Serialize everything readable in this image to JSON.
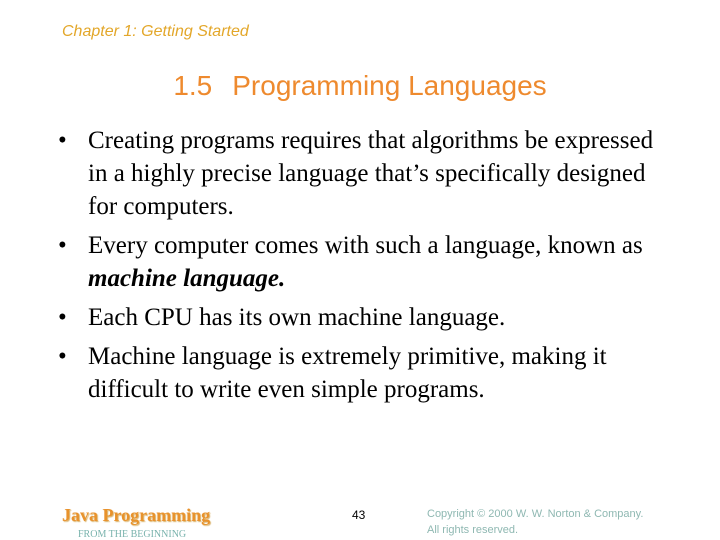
{
  "header": {
    "chapter": "Chapter 1: Getting Started"
  },
  "title": {
    "number": "1.5",
    "text": "Programming Languages"
  },
  "bullets": [
    {
      "text": "Creating programs requires that algorithms be expressed in a highly precise language that’s specifically designed for computers."
    },
    {
      "text_before": "Every computer comes with such a language, known as ",
      "emphasis": "machine language."
    },
    {
      "text": "Each CPU has its own machine language."
    },
    {
      "text": "Machine language is extremely primitive, making it difficult to write even simple programs."
    }
  ],
  "bullet_glyph": "•",
  "footer": {
    "brand": "Java Programming",
    "subtitle": "FROM THE BEGINNING",
    "page_number": "43",
    "copyright_line1": "Copyright © 2000 W. W. Norton & Company.",
    "copyright_line2": "All rights reserved."
  },
  "colors": {
    "chapter": "#e3a72a",
    "title": "#ee8a2e",
    "brand": "#e8922c",
    "subtitle": "#7ab3ad",
    "copyright": "#8fb8b2"
  }
}
